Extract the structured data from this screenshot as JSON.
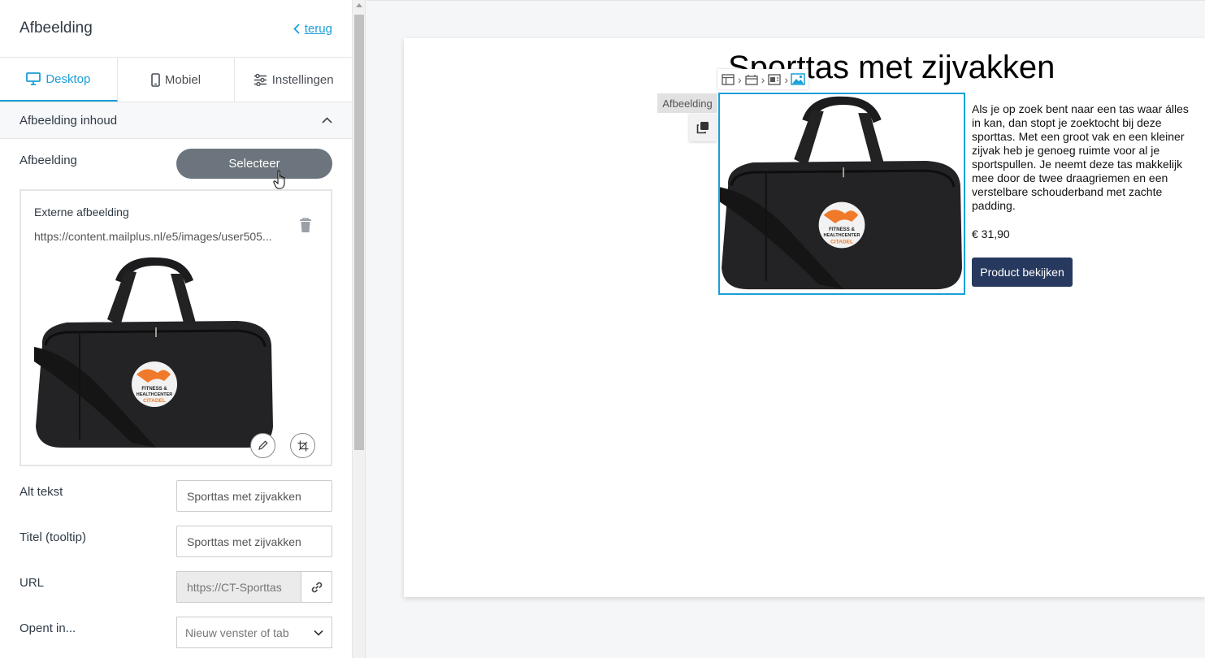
{
  "panel": {
    "title": "Afbeelding",
    "back_label": "terug",
    "tabs": [
      {
        "label": "Desktop",
        "icon": "monitor-icon",
        "active": true
      },
      {
        "label": "Mobiel",
        "icon": "phone-icon",
        "active": false
      },
      {
        "label": "Instellingen",
        "icon": "sliders-icon",
        "active": false
      }
    ],
    "section_title": "Afbeelding inhoud",
    "image_label": "Afbeelding",
    "select_button": "Selecteer",
    "external": {
      "title": "Externe afbeelding",
      "url": "https://content.mailplus.nl/e5/images/user505..."
    },
    "fields": {
      "alt_label": "Alt tekst",
      "alt_value": "Sporttas met zijvakken",
      "title_label": "Titel (tooltip)",
      "title_value": "Sporttas met zijvakken",
      "url_label": "URL",
      "url_value": "https://CT-Sporttas",
      "open_label": "Opent in...",
      "open_value": "Nieuw venster of tab"
    }
  },
  "canvas": {
    "doc_title": "Sporttas met zijvakken",
    "block_label": "Afbeelding",
    "logo_text": [
      "FITNESS &",
      "HEALTHCENTER",
      "CITADEL"
    ],
    "description": "Als je op zoek bent naar een tas waar álles in kan, dan stopt je zoektocht bij deze sporttas. Met een groot vak en een kleiner zijvak heb je genoeg ruimte voor al je sportspullen. Je neemt deze tas makkelijk mee door de twee draagriemen en een verstelbare schouderband met zachte padding.",
    "price": "€ 31,90",
    "product_button": "Product bekijken"
  },
  "colors": {
    "accent": "#1a9fd8",
    "select_button": "#6c757d",
    "product_button": "#27395e",
    "logo_orange": "#f07a2a"
  }
}
